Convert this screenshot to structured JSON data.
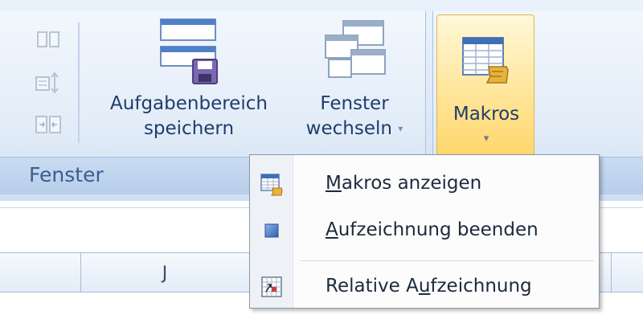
{
  "ribbon": {
    "group_fenster": {
      "label": "Fenster",
      "save_workspace": {
        "line1": "Aufgabenbereich",
        "line2": "speichern"
      },
      "switch_windows": {
        "line1": "Fenster",
        "line2": "wechseln"
      }
    },
    "group_makros": {
      "button_label": "Makros"
    }
  },
  "sheet": {
    "column_header": "J"
  },
  "dropdown": {
    "items": [
      {
        "accel": "M",
        "rest": "akros anzeigen",
        "icon": "macro-list-icon"
      },
      {
        "accel": "A",
        "rest": "ufzeichnung beenden",
        "icon": "stop-recording-icon"
      },
      {
        "prefix": "Relative A",
        "accel": "u",
        "rest": "fzeichnung",
        "icon": "relative-reference-icon"
      }
    ]
  },
  "colors": {
    "ribbon_text": "#1f3d6b",
    "group_label": "#3a5e8f",
    "makros_highlight": "#ffd66e"
  }
}
